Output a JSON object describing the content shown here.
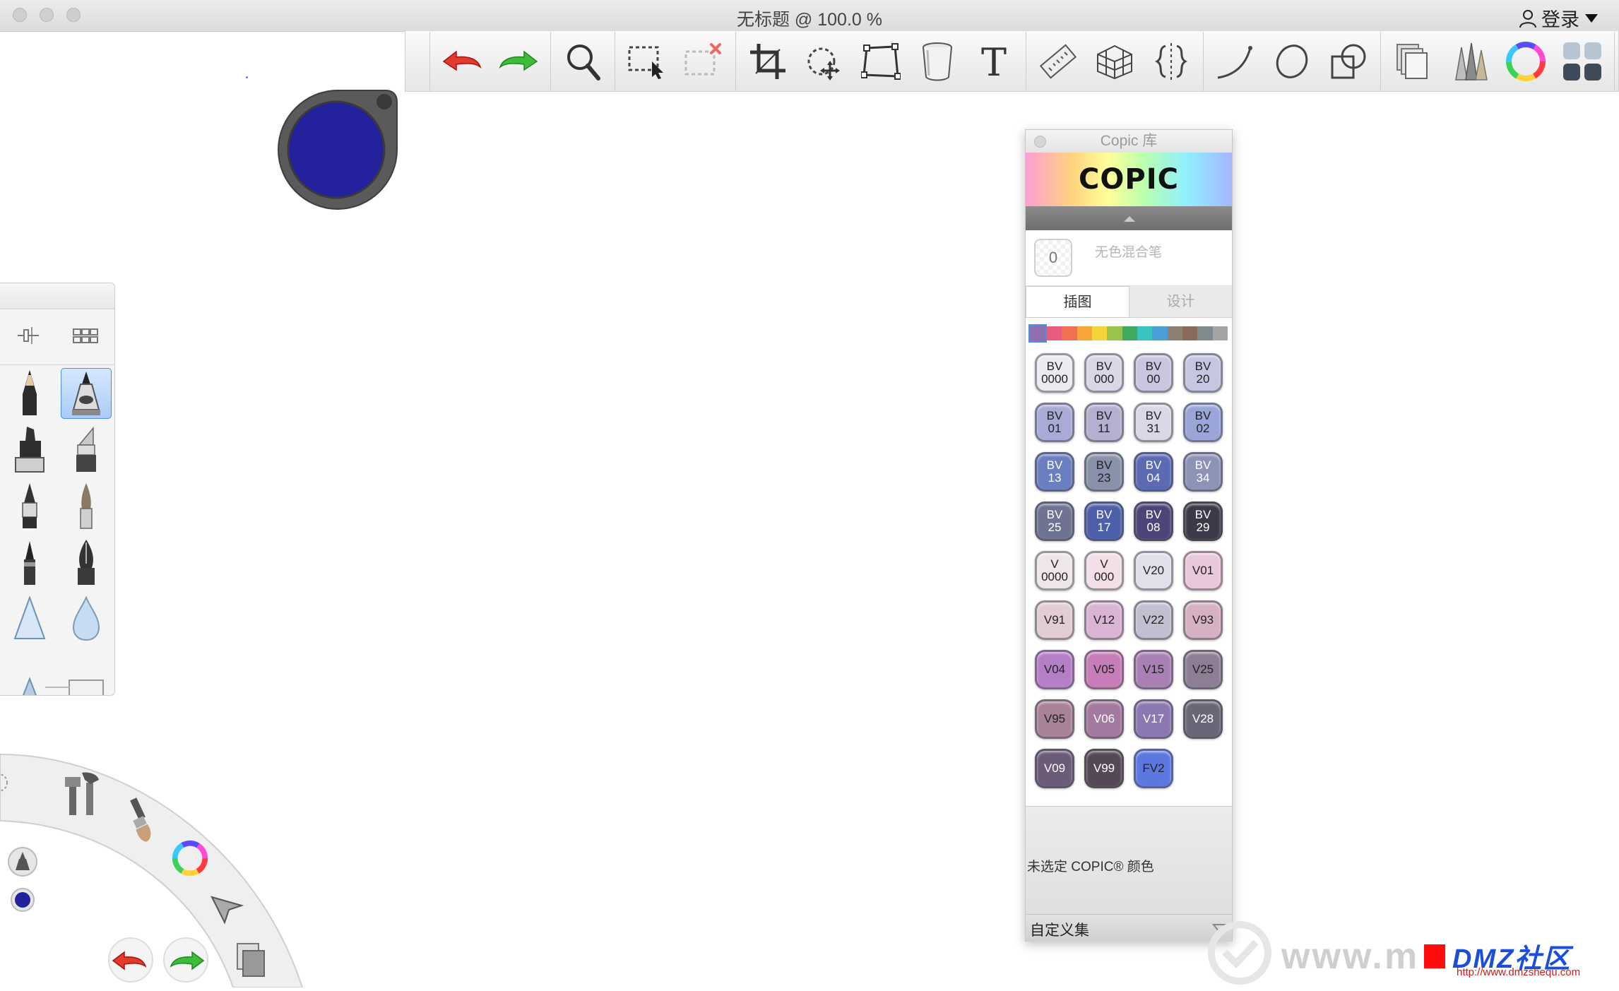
{
  "window": {
    "title": "无标题 @ 100.0 %",
    "login_label": "登录"
  },
  "toolbar": {
    "groups": [
      [
        "undo-icon",
        "redo-icon"
      ],
      [
        "magnifier-icon"
      ],
      [
        "rectangle-select-icon",
        "clear-selection-icon"
      ],
      [
        "crop-icon",
        "transform-icon",
        "distort-icon",
        "fill-bucket-icon",
        "text-icon"
      ],
      [
        "ruler-icon",
        "perspective-grid-icon",
        "symmetry-icon"
      ],
      [
        "stroke-icon",
        "ellipse-icon",
        "shapes-icon"
      ],
      [
        "layers-icon",
        "brush-library-icon",
        "color-wheel-icon",
        "brush-palette-icon"
      ]
    ]
  },
  "brush_puck": {
    "color": "#23229c"
  },
  "brush_palette": {
    "brushes": [
      "pencil",
      "airbrush",
      "marker",
      "chisel-marker",
      "ballpoint",
      "paintbrush",
      "felt-pen",
      "fountain-pen",
      "smudge",
      "blur",
      "triangle",
      "eraser"
    ],
    "selected_index": 1
  },
  "lagoon": {
    "current_color": "#23229c"
  },
  "copic": {
    "panel_title": "Copic 库",
    "logo": "COPIC",
    "blender_code": "0",
    "blender_label": "无色混合笔",
    "tabs": [
      "插图",
      "设计"
    ],
    "active_tab": 0,
    "family_colors": [
      "#8f6fb0",
      "#e85b7c",
      "#f0734f",
      "#f6a53a",
      "#f5d33a",
      "#9bc24a",
      "#3daa5e",
      "#3cc3c0",
      "#4a9fd6",
      "#8b7f71",
      "#8a6a5c",
      "#7d8b8c",
      "#a3a3a3"
    ],
    "selected_family": 0,
    "swatches": [
      {
        "label": "BV\n0000",
        "color": "#ecebf2"
      },
      {
        "label": "BV\n000",
        "color": "#d9d6e6"
      },
      {
        "label": "BV\n00",
        "color": "#cbc6df"
      },
      {
        "label": "BV\n20",
        "color": "#c4c6e2"
      },
      {
        "label": "BV\n01",
        "color": "#a9abd6"
      },
      {
        "label": "BV\n11",
        "color": "#b3b0d0"
      },
      {
        "label": "BV\n31",
        "color": "#d8d8e6"
      },
      {
        "label": "BV\n02",
        "color": "#9aa6d8"
      },
      {
        "label": "BV\n13",
        "color": "#6a7ec0",
        "light": true
      },
      {
        "label": "BV\n23",
        "color": "#8a91ab"
      },
      {
        "label": "BV\n04",
        "color": "#5c6ab4",
        "light": true
      },
      {
        "label": "BV\n34",
        "color": "#8c93b6",
        "light": true
      },
      {
        "label": "BV\n25",
        "color": "#6e7391",
        "light": true
      },
      {
        "label": "BV\n17",
        "color": "#4d5fa8",
        "light": true
      },
      {
        "label": "BV\n08",
        "color": "#4e4478",
        "light": true
      },
      {
        "label": "BV\n29",
        "color": "#3a3a48",
        "light": true
      },
      {
        "label": "V\n0000",
        "color": "#efe6ea"
      },
      {
        "label": "V\n000",
        "color": "#f2dfe8"
      },
      {
        "label": "V20",
        "color": "#e0dfea"
      },
      {
        "label": "V01",
        "color": "#eac8dc"
      },
      {
        "label": "V91",
        "color": "#e2cdd4"
      },
      {
        "label": "V12",
        "color": "#d9b5d3"
      },
      {
        "label": "V22",
        "color": "#c4bfd0"
      },
      {
        "label": "V93",
        "color": "#d6b1c4"
      },
      {
        "label": "V04",
        "color": "#b57fc7"
      },
      {
        "label": "V05",
        "color": "#c77db7"
      },
      {
        "label": "V15",
        "color": "#a980b4"
      },
      {
        "label": "V25",
        "color": "#8d7e96"
      },
      {
        "label": "V95",
        "color": "#a88397"
      },
      {
        "label": "V06",
        "color": "#a37a9f",
        "light": true
      },
      {
        "label": "V17",
        "color": "#8c78b0",
        "light": true
      },
      {
        "label": "V28",
        "color": "#6a6678",
        "light": true
      },
      {
        "label": "V09",
        "color": "#6b5a78",
        "light": true
      },
      {
        "label": "V99",
        "color": "#544856",
        "light": true
      },
      {
        "label": "FV2",
        "color": "#5c78e0"
      }
    ],
    "status_text": "未选定 COPIC® 颜色",
    "custom_set_label": "自定义集"
  },
  "watermark": {
    "text": "www.m",
    "brand": "DMZ社区",
    "url": "http://www.dmzshequ.com"
  }
}
